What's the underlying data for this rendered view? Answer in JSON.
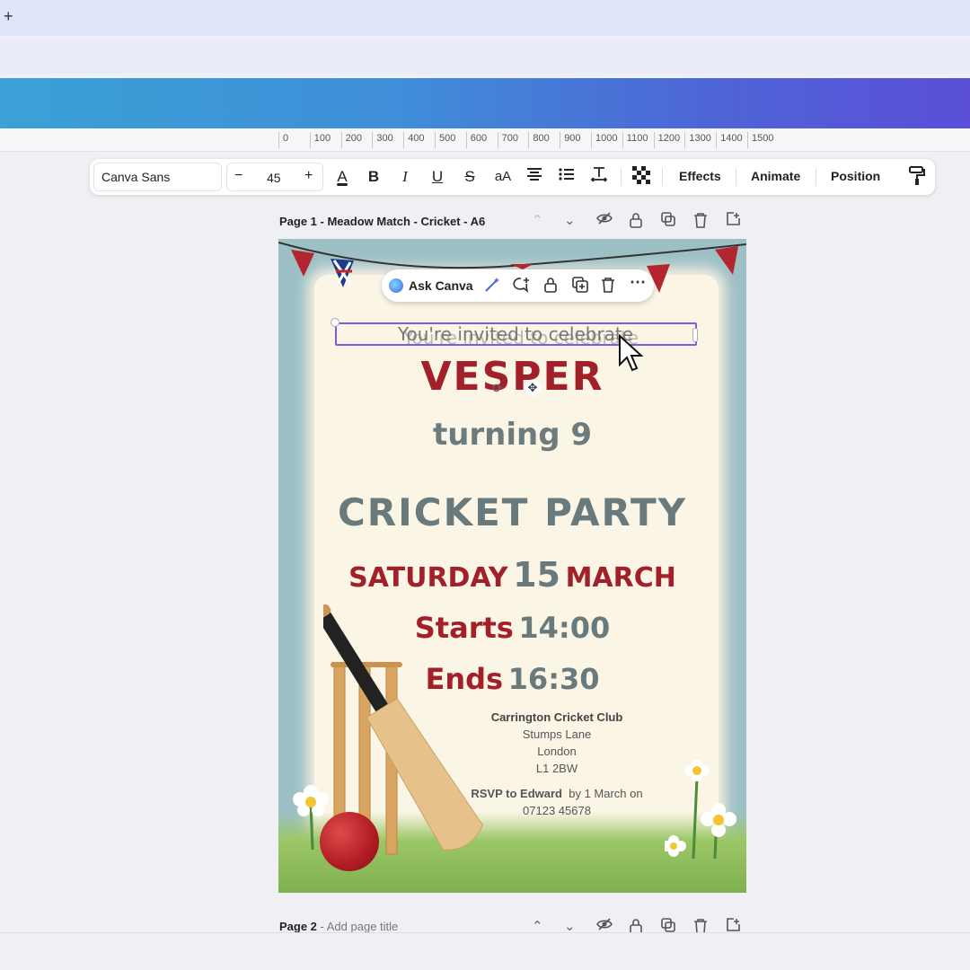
{
  "browser": {
    "new_tab": "+"
  },
  "ruler": {
    "marks": [
      "0",
      "100",
      "200",
      "300",
      "400",
      "500",
      "600",
      "700",
      "800",
      "900",
      "1000",
      "1100",
      "1200",
      "1300",
      "1400",
      "1500"
    ]
  },
  "toolbar": {
    "font": "Canva Sans",
    "size_minus": "−",
    "size": "45",
    "size_plus": "+",
    "text_color": "A",
    "bold": "B",
    "italic": "I",
    "underline": "U",
    "strike": "S",
    "case": "aA",
    "effects": "Effects",
    "animate": "Animate",
    "position": "Position"
  },
  "page1": {
    "label": "Page 1 - Meadow Match - Cricket - A6"
  },
  "context_bar": {
    "ask": "Ask Canva"
  },
  "design": {
    "invite": "You're invited to celebrate",
    "name": "VESPER",
    "turning": "turning 9",
    "party": "CRICKET PARTY",
    "day": "SATURDAY",
    "date_num": "15",
    "month": "MARCH",
    "starts_label": "Starts",
    "starts_time": "14:00",
    "ends_label": "Ends",
    "ends_time": "16:30",
    "venue_name": "Carrington Cricket Club",
    "venue_street": "Stumps Lane",
    "venue_city": "London",
    "venue_postcode": "L1 2BW",
    "rsvp_bold": "RSVP to Edward",
    "rsvp_rest": "by 1 March on",
    "phone": "07123 45678"
  },
  "page2": {
    "label": "Page 2",
    "placeholder": " - Add page title"
  },
  "colors": {
    "accent": "#7b5ae6",
    "red": "#a2202a",
    "grey": "#687a7c",
    "sky": "#9dc0c6",
    "paper": "#fbf5e6"
  }
}
